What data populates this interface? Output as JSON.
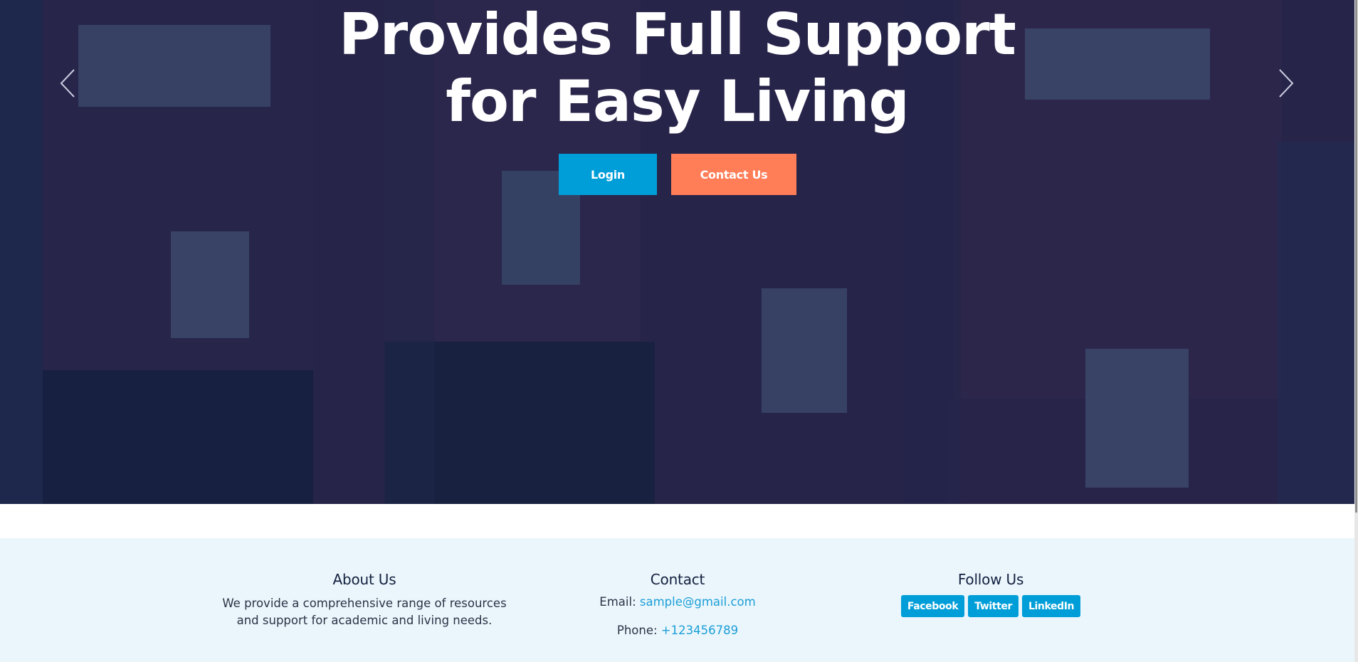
{
  "hero": {
    "title_line1": "Provides Full Support",
    "title_line2": "for Easy Living",
    "login_label": "Login",
    "contact_label": "Contact Us"
  },
  "footer": {
    "about": {
      "heading": "About Us",
      "text": "We provide a comprehensive range of resources and support for academic and living needs."
    },
    "contact": {
      "heading": "Contact",
      "email_label": "Email:",
      "email": "sample@gmail.com",
      "phone_label": "Phone:",
      "phone": "+123456789"
    },
    "follow": {
      "heading": "Follow Us",
      "links": [
        "Facebook",
        "Twitter",
        "LinkedIn"
      ]
    }
  },
  "icons": {
    "prev": "chevron-left-icon",
    "next": "chevron-right-icon"
  },
  "colors": {
    "primary": "#009ed8",
    "accent": "#ff7e58",
    "footer_bg": "#ebf6fc",
    "heading": "#13213f"
  }
}
